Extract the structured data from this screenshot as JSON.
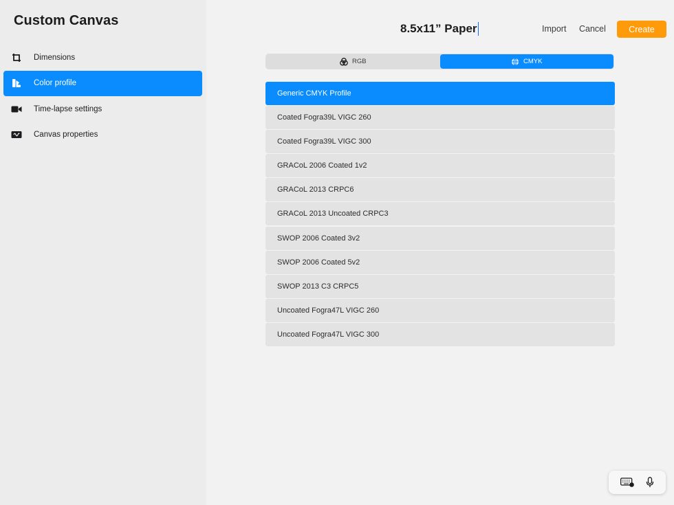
{
  "sidebar": {
    "title": "Custom Canvas",
    "items": [
      {
        "label": "Dimensions",
        "icon": "crop-icon"
      },
      {
        "label": "Color profile",
        "icon": "color-swatch-icon",
        "active": true
      },
      {
        "label": "Time-lapse settings",
        "icon": "video-camera-icon"
      },
      {
        "label": "Canvas properties",
        "icon": "canvas-properties-icon"
      }
    ]
  },
  "header": {
    "title": "8.5x11” Paper",
    "import_label": "Import",
    "cancel_label": "Cancel",
    "create_label": "Create"
  },
  "segments": [
    {
      "label": "RGB",
      "icon": "rgb-circles-icon"
    },
    {
      "label": "CMYK",
      "icon": "cmyk-globe-icon",
      "active": true
    }
  ],
  "profiles": [
    "Generic CMYK Profile",
    "Coated Fogra39L VIGC 260",
    "Coated Fogra39L VIGC 300",
    "GRACoL 2006 Coated 1v2",
    "GRACoL 2013 CRPC6",
    "GRACoL 2013 Uncoated CRPC3",
    "SWOP 2006 Coated 3v2",
    "SWOP 2006 Coated 5v2",
    "SWOP 2013 C3 CRPC5",
    "Uncoated Fogra47L VIGC 260",
    "Uncoated Fogra47L VIGC 300"
  ],
  "selected_profile": "Generic CMYK Profile",
  "colors": {
    "accent": "#0a8cfe",
    "create_button": "#ff9a0a"
  },
  "keyboard_bar": {
    "icons": [
      "keyboard-dismiss-icon",
      "microphone-icon"
    ]
  }
}
